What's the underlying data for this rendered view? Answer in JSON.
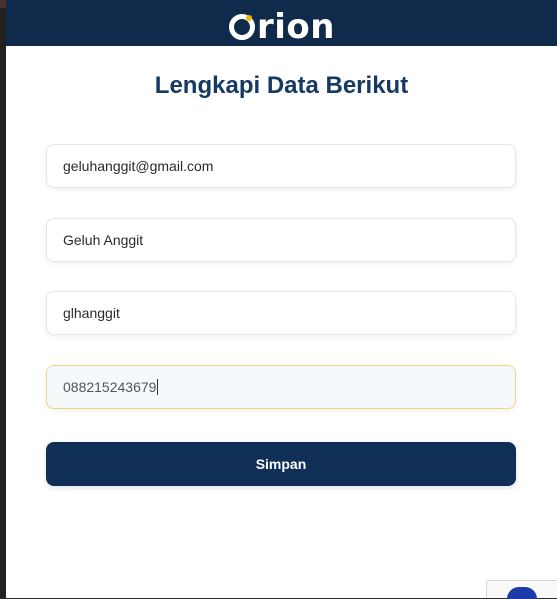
{
  "brand": {
    "logo_text": "rion",
    "logo_icon": "orion-o-logo-icon"
  },
  "form": {
    "title": "Lengkapi Data Berikut",
    "fields": [
      {
        "value": "geluhanggit@gmail.com"
      },
      {
        "value": "Geluh Anggit"
      },
      {
        "value": "glhanggit"
      },
      {
        "value": "088215243679"
      }
    ],
    "submit_label": "Simpan"
  },
  "colors": {
    "header_bg": "#0f2a4a",
    "title": "#163a63",
    "button_bg": "#0f2f57",
    "active_border": "#f1d77a",
    "logo_accent": "#f2b705"
  }
}
